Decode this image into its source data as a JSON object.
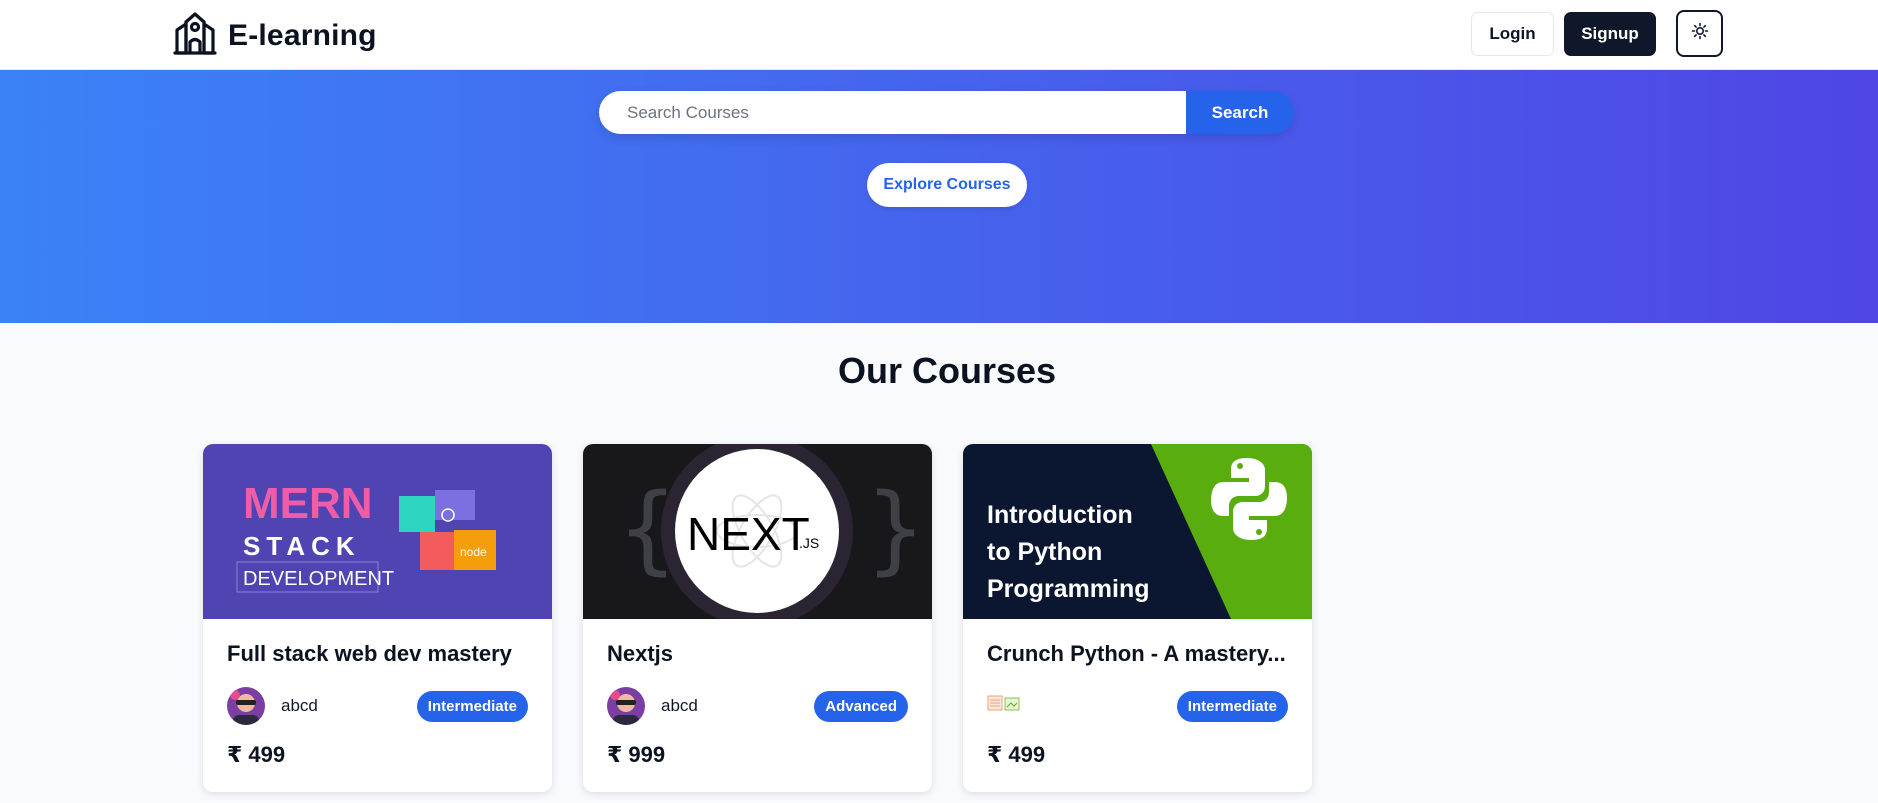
{
  "navbar": {
    "brand": "E-learning",
    "login_label": "Login",
    "signup_label": "Signup"
  },
  "hero": {
    "search_placeholder": "Search Courses",
    "search_button": "Search",
    "explore_button": "Explore Courses"
  },
  "courses": {
    "title": "Our Courses",
    "items": [
      {
        "title": "Full stack web dev mastery",
        "author": "abcd",
        "level": "Intermediate",
        "price": "₹ 499",
        "image_text": [
          "MERN",
          "STACK",
          "DEVELOPMENT",
          "node"
        ]
      },
      {
        "title": "Nextjs",
        "author": "abcd",
        "level": "Advanced",
        "price": "₹ 999",
        "image_text": [
          "NEXT",
          ".JS"
        ]
      },
      {
        "title": "Crunch Python - A mastery...",
        "author": "",
        "level": "Intermediate",
        "price": "₹ 499",
        "image_text": [
          "Introduction",
          "to Python",
          "Programming"
        ]
      }
    ]
  },
  "colors": {
    "hero_start": "#3b82f6",
    "hero_end": "#4f46e5",
    "accent": "#2563eb",
    "dark": "#0f172a"
  }
}
